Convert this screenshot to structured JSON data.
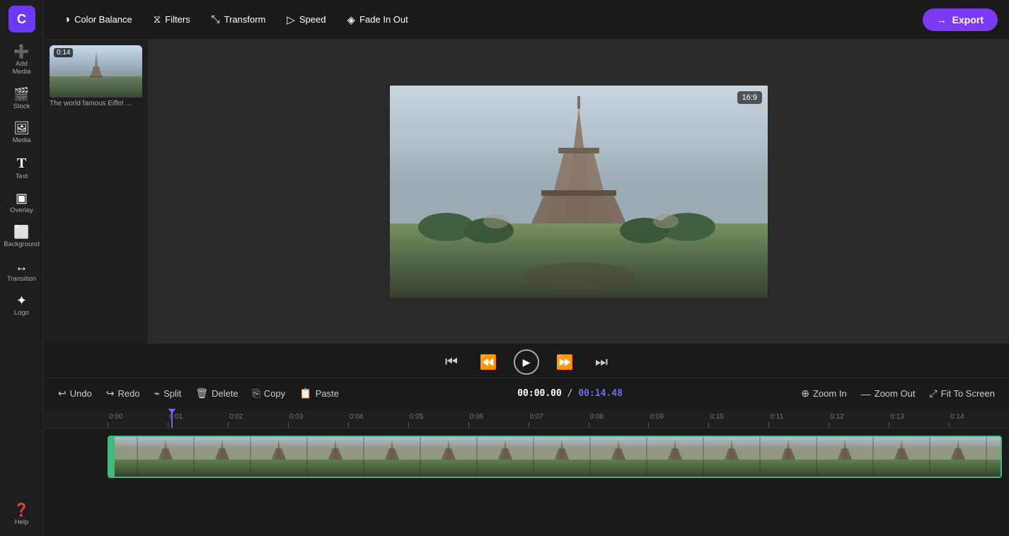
{
  "app": {
    "logo_letter": "C",
    "aspect_ratio": "16:9"
  },
  "sidebar": {
    "items": [
      {
        "id": "add-media",
        "label": "Add Media",
        "icon": "➕"
      },
      {
        "id": "stock",
        "label": "Stock",
        "icon": "🎬"
      },
      {
        "id": "media",
        "label": "Media",
        "icon": "🖼"
      },
      {
        "id": "text",
        "label": "Text",
        "icon": "T"
      },
      {
        "id": "overlay",
        "label": "Overlay",
        "icon": "▣"
      },
      {
        "id": "background",
        "label": "Background",
        "icon": "⬜"
      },
      {
        "id": "transition",
        "label": "Transition",
        "icon": "↔"
      },
      {
        "id": "logo",
        "label": "Logo",
        "icon": "✦"
      }
    ]
  },
  "toolbar": {
    "color_balance": "Color Balance",
    "filters": "Filters",
    "transform": "Transform",
    "speed": "Speed",
    "fade_in_out": "Fade In Out",
    "export": "Export"
  },
  "media_panel": {
    "item": {
      "duration": "0:14",
      "title": "The world famous Eiffel …"
    }
  },
  "timeline": {
    "current_time": "00:00.00",
    "total_time": "00:14.48",
    "undo": "Undo",
    "redo": "Redo",
    "split": "Split",
    "delete": "Delete",
    "copy": "Copy",
    "paste": "Paste",
    "zoom_in": "Zoom In",
    "zoom_out": "Zoom Out",
    "fit_to_screen": "Fit To Screen",
    "ruler_marks": [
      "0:00",
      "0:01",
      "0:02",
      "0:03",
      "0:04",
      "0:05",
      "0:06",
      "0:07",
      "0:08",
      "0:09",
      "0:10",
      "0:11",
      "0:12",
      "0:13",
      "0:14"
    ]
  },
  "playback": {
    "skip_start": "⏮",
    "rewind": "⏪",
    "play": "▶",
    "fast_forward": "⏩",
    "skip_end": "⏭"
  }
}
